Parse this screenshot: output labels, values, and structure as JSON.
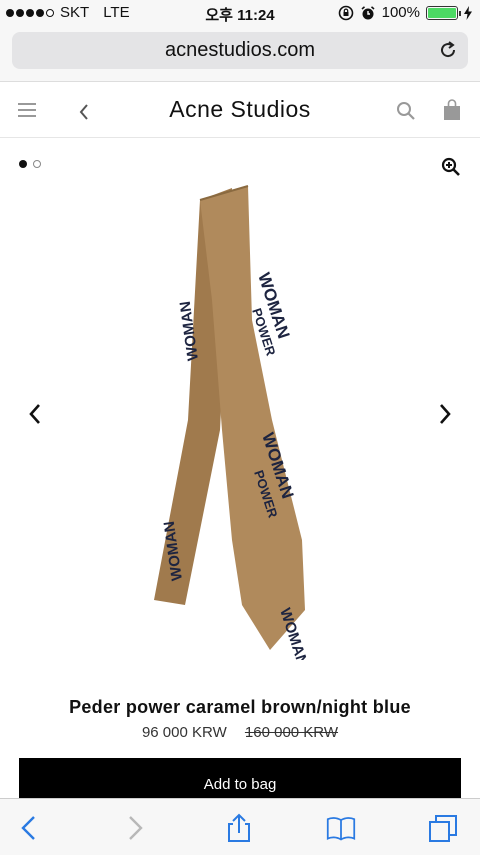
{
  "status": {
    "carrier": "SKT",
    "network": "LTE",
    "time": "오후 11:24",
    "battery": "100%"
  },
  "browser": {
    "url": "acnestudios.com"
  },
  "header": {
    "brand": "Acne Studios"
  },
  "product": {
    "name": "Peder power caramel brown/night blue",
    "price": "96 000 KRW",
    "old_price": "160 000 KRW",
    "add_to_bag": "Add to bag",
    "print_text": [
      "WOMAN",
      "POWER"
    ]
  },
  "gallery": {
    "current_image": 1,
    "image_count": 2
  },
  "colors": {
    "tie": "#b08a5c",
    "print": "#1d2440",
    "add_button": "#000000"
  }
}
